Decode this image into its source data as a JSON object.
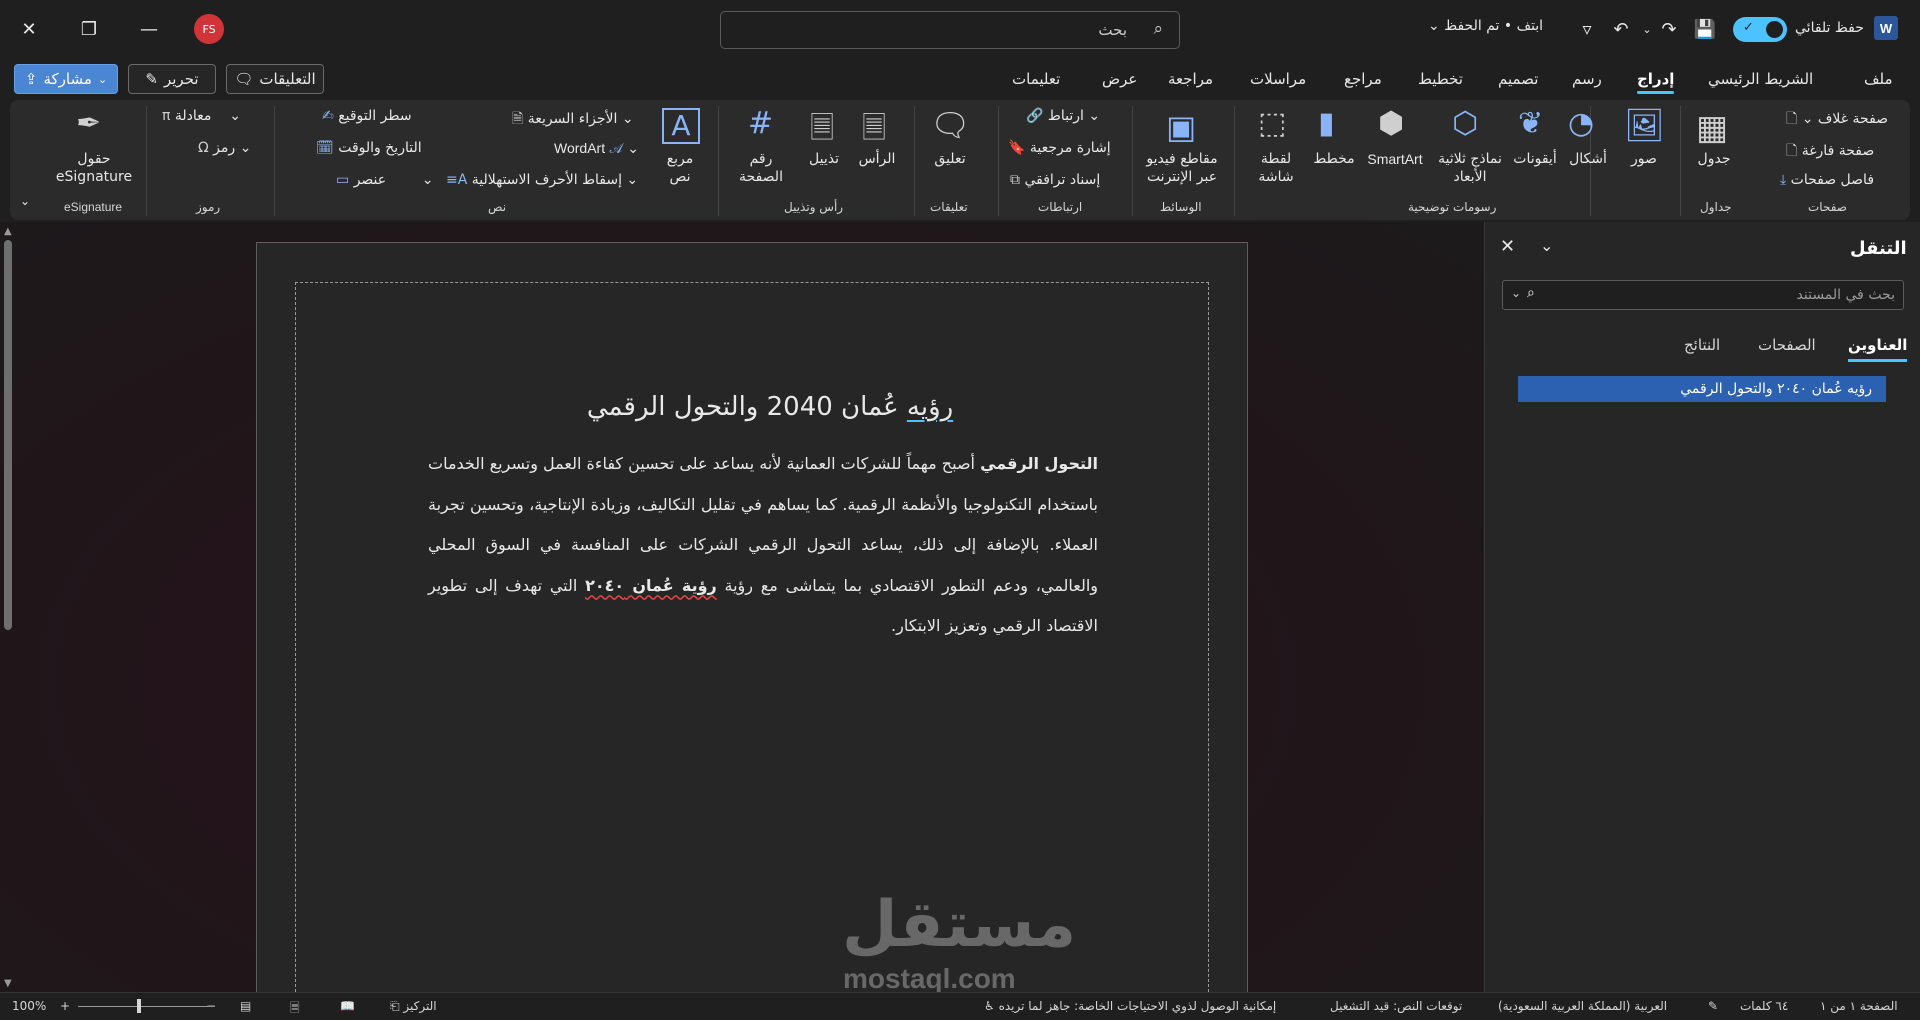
{
  "titlebar": {
    "avatar_initials": "FS",
    "search_placeholder": "بحث",
    "doc_status": "ابتف • تم الحفظ",
    "autosave_label": "حفظ تلقائي",
    "word_logo": "W",
    "icons": [
      "close-icon",
      "restore-icon",
      "minimize-icon",
      "search-icon",
      "undo-icon",
      "redo-icon",
      "save-icon",
      "customize-icon"
    ]
  },
  "ribbon_tabs": {
    "file": "ملف",
    "home": "الشريط الرئيسي",
    "insert": "إدراج",
    "draw": "رسم",
    "design": "تصميم",
    "layout": "تخطيط",
    "references": "مراجع",
    "mailings": "مراسلات",
    "review": "مراجعة",
    "view": "عرض",
    "help": "تعليمات",
    "comments_btn": "التعليقات",
    "edit_btn": "تحرير",
    "share_btn": "مشاركة"
  },
  "ribbon": {
    "pages": {
      "label": "صفحات",
      "cover": "صفحة غلاف",
      "blank": "صفحة فارغة",
      "break": "فاصل صفحات"
    },
    "tables": {
      "label": "جداول",
      "table": "جدول"
    },
    "illustrations": {
      "label": "رسومات توضيحية",
      "pictures": "صور",
      "shapes": "أشكال",
      "icons": "أيقونات",
      "models_3d": "نماذج ثلاثية الأبعاد",
      "smartart": "SmartArt",
      "chart": "مخطط",
      "screenshot": "لقطة شاشة"
    },
    "media": {
      "label": "الوسائط",
      "online_video": "مقاطع فيديو عبر الإنترنت"
    },
    "links": {
      "label": "ارتباطات",
      "link": "ارتباط",
      "bookmark": "إشارة مرجعية",
      "cross_ref": "إسناد ترافقي"
    },
    "comments": {
      "label": "تعليقات",
      "comment": "تعليق"
    },
    "header_footer": {
      "label": "رأس وتذييل",
      "header": "الرأس",
      "footer": "تذييل",
      "page_number": "رقم الصفحة"
    },
    "text": {
      "label": "نص",
      "textbox": "مربع نص",
      "quick_parts": "الأجزاء السريعة",
      "wordart": "WordArt",
      "dropcap": "إسقاط الأحرف الاستهلالية",
      "signature_line": "سطر التوقيع",
      "date_time": "التاريخ والوقت",
      "object": "عنصر"
    },
    "symbols": {
      "label": "رموز",
      "equation": "معادلة",
      "symbol": "رمز"
    },
    "esignature": {
      "label": "eSignature",
      "fields": "حقول eSignature"
    }
  },
  "document": {
    "title_part1": "رؤيه",
    "title_part2": "عُمان 2040 والتحول الرقمي",
    "body_bold_start": "التحول الرقمي",
    "body_text": "أصبح مهماً للشركات العمانية لأنه يساعد على تحسين كفاءة العمل وتسريع الخدمات باستخدام التكنولوجيا والأنظمة الرقمية. كما يساهم في تقليل التكاليف، وزيادة الإنتاجية، وتحسين تجربة العملاء. بالإضافة إلى ذلك، يساعد التحول الرقمي الشركات على المنافسة في السوق المحلي والعالمي، ودعم التطور الاقتصادي بما يتماشى مع رؤية",
    "body_bold_end": "رؤية عُمان ٢٠٤٠",
    "body_tail": "التي تهدف إلى تطوير الاقتصاد الرقمي وتعزيز الابتكار.",
    "watermark_ar": "مستقل",
    "watermark_en": "mostaql.com"
  },
  "nav_pane": {
    "title": "التنقل",
    "search_placeholder": "بحث في المستند",
    "tabs": [
      "العناوين",
      "الصفحات",
      "النتائج"
    ],
    "heading_item": "رؤيه عُمان ٢٠٤٠ والتحول الرقمي"
  },
  "statusbar": {
    "page": "الصفحة ١ من ١",
    "words": "٦٤ كلمات",
    "language": "العربية (المملكة العربية السعودية)",
    "text_predictions": "توقعات النص: قيد التشغيل",
    "accessibility": "إمكانية الوصول لذوي الاحتياجات الخاصة: جاهز لما تريده",
    "focus": "التركيز",
    "zoom": "100%",
    "zoom_fraction": 0.45
  }
}
